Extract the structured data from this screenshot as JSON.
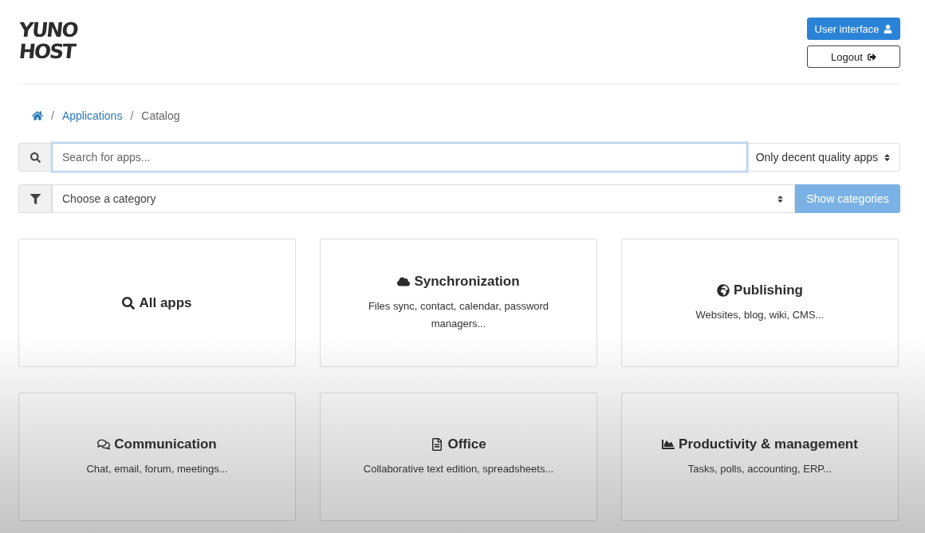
{
  "logo": {
    "lines": [
      "YUNO",
      "HOST"
    ]
  },
  "header_buttons": [
    {
      "label": "User interface",
      "kind": "primary"
    },
    {
      "label": "Logout",
      "kind": "outline"
    }
  ],
  "breadcrumb": {
    "items": [
      {
        "separator": "/",
        "label": "Applications",
        "kind": "link"
      },
      {
        "separator": "/",
        "label": "Catalog",
        "kind": "current"
      }
    ]
  },
  "search": {
    "placeholder": "Search for apps...",
    "focused": true,
    "quality_filter": "Only decent quality apps"
  },
  "category_filter": {
    "placeholder": "Choose a category",
    "button": "Show categories"
  },
  "categories": [
    {
      "title": "All apps"
    },
    {
      "title": "Synchronization",
      "description": "Files sync, contact, calendar, password managers..."
    },
    {
      "title": "Publishing",
      "description": "Websites, blog, wiki, CMS..."
    },
    {
      "title": "Communication",
      "description": "Chat, email, forum, meetings..."
    },
    {
      "title": "Office",
      "description": "Collaborative text edition, spreadsheets..."
    },
    {
      "title": "Productivity & management",
      "description": "Tasks, polls, accounting, ERP..."
    }
  ]
}
